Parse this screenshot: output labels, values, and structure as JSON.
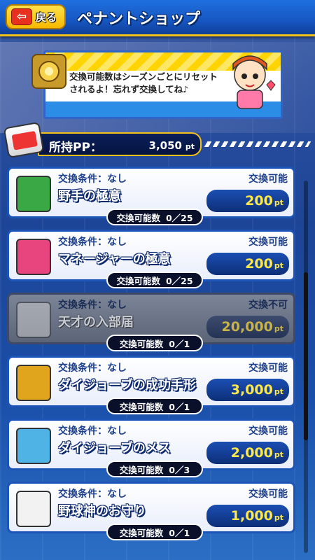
{
  "header": {
    "back_label": "戻る",
    "title": "ペナントショップ"
  },
  "notice": {
    "line1": "交換可能数はシーズンごとにリセット",
    "line2": "されるよ！忘れず交換してね♪"
  },
  "pp": {
    "label": "所持PP：",
    "value": "3,050",
    "unit": "pt"
  },
  "items": [
    {
      "condition": "交換条件：なし",
      "status": "交換可能",
      "name": "野手の極意",
      "price": "200",
      "unit": "pt",
      "count_label": "交換可能数",
      "count": "0／25",
      "icon": "glove-card-icon",
      "icon_color": "#3aa845",
      "disabled": false
    },
    {
      "condition": "交換条件：なし",
      "status": "交換可能",
      "name": "マネージャーの極意",
      "price": "200",
      "unit": "pt",
      "count_label": "交換可能数",
      "count": "0／25",
      "icon": "fan-card-icon",
      "icon_color": "#e8457f",
      "disabled": false
    },
    {
      "condition": "交換条件：なし",
      "status": "交換不可",
      "name": "天才の入部届",
      "price": "20,000",
      "unit": "pt",
      "count_label": "交換可能数",
      "count": "0／1",
      "icon": "document-icon",
      "icon_color": "#c9c9c9",
      "disabled": true
    },
    {
      "condition": "交換条件：なし",
      "status": "交換可能",
      "name": "ダイジョーブの成功手形",
      "price": "3,000",
      "unit": "pt",
      "count_label": "交換可能数",
      "count": "0／1",
      "icon": "seal-tag-icon",
      "icon_color": "#e0a51c",
      "disabled": false
    },
    {
      "condition": "交換条件：なし",
      "status": "交換可能",
      "name": "ダイジョーブのメス",
      "price": "2,000",
      "unit": "pt",
      "count_label": "交換可能数",
      "count": "0／3",
      "icon": "scalpel-icon",
      "icon_color": "#4fb3e6",
      "disabled": false
    },
    {
      "condition": "交換条件：なし",
      "status": "交換可能",
      "name": "野球神のお守り",
      "price": "1,000",
      "unit": "pt",
      "count_label": "交換可能数",
      "count": "0／1",
      "icon": "charm-icon",
      "icon_color": "#f2f2f2",
      "disabled": false
    }
  ],
  "scroll": {
    "position": 0.45
  }
}
